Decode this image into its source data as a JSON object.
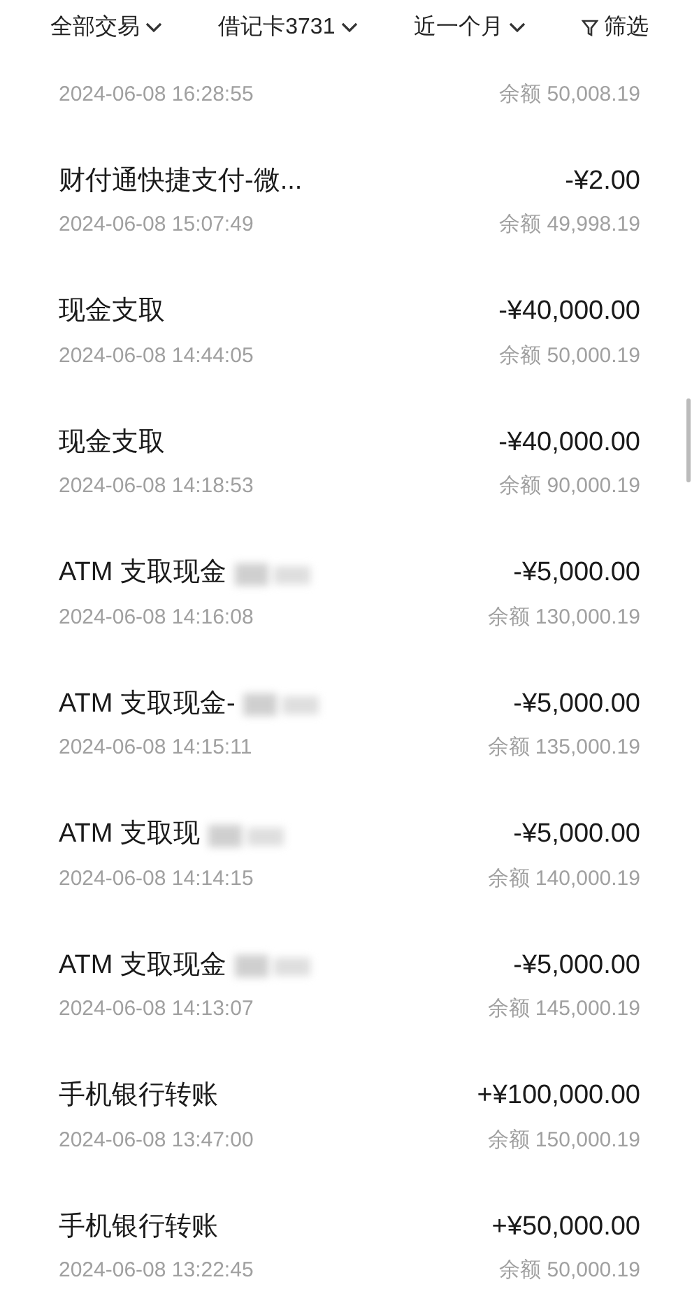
{
  "filters": [
    {
      "label": "全部交易",
      "kind": "dropdown"
    },
    {
      "label": "借记卡3731",
      "kind": "dropdown"
    },
    {
      "label": "近一个月",
      "kind": "dropdown"
    },
    {
      "label": "筛选",
      "kind": "filter"
    }
  ],
  "partial_row": {
    "date": "2024-06-08 16:28:55",
    "balance_label": "余额",
    "balance": "50,008.19"
  },
  "transactions": [
    {
      "title": "财付通快捷支付-微...",
      "amount": "-¥2.00",
      "date": "2024-06-08 15:07:49",
      "balance_label": "余额",
      "balance": "49,998.19",
      "redacted": false
    },
    {
      "title": "现金支取",
      "amount": "-¥40,000.00",
      "date": "2024-06-08 14:44:05",
      "balance_label": "余额",
      "balance": "50,000.19",
      "redacted": false
    },
    {
      "title": "现金支取",
      "amount": "-¥40,000.00",
      "date": "2024-06-08 14:18:53",
      "balance_label": "余额",
      "balance": "90,000.19",
      "redacted": false
    },
    {
      "title": "ATM 支取现金",
      "amount": "-¥5,000.00",
      "date": "2024-06-08 14:16:08",
      "balance_label": "余额",
      "balance": "130,000.19",
      "redacted": true
    },
    {
      "title": "ATM 支取现金-",
      "amount": "-¥5,000.00",
      "date": "2024-06-08 14:15:11",
      "balance_label": "余额",
      "balance": "135,000.19",
      "redacted": true
    },
    {
      "title": "ATM 支取现",
      "amount": "-¥5,000.00",
      "date": "2024-06-08 14:14:15",
      "balance_label": "余额",
      "balance": "140,000.19",
      "redacted": true
    },
    {
      "title": "ATM 支取现金",
      "amount": "-¥5,000.00",
      "date": "2024-06-08 14:13:07",
      "balance_label": "余额",
      "balance": "145,000.19",
      "redacted": true
    },
    {
      "title": "手机银行转账",
      "amount": "+¥100,000.00",
      "date": "2024-06-08 13:47:00",
      "balance_label": "余额",
      "balance": "150,000.19",
      "redacted": false
    },
    {
      "title": "手机银行转账",
      "amount": "+¥50,000.00",
      "date": "2024-06-08 13:22:45",
      "balance_label": "余额",
      "balance": "50,000.19",
      "redacted": false
    }
  ]
}
